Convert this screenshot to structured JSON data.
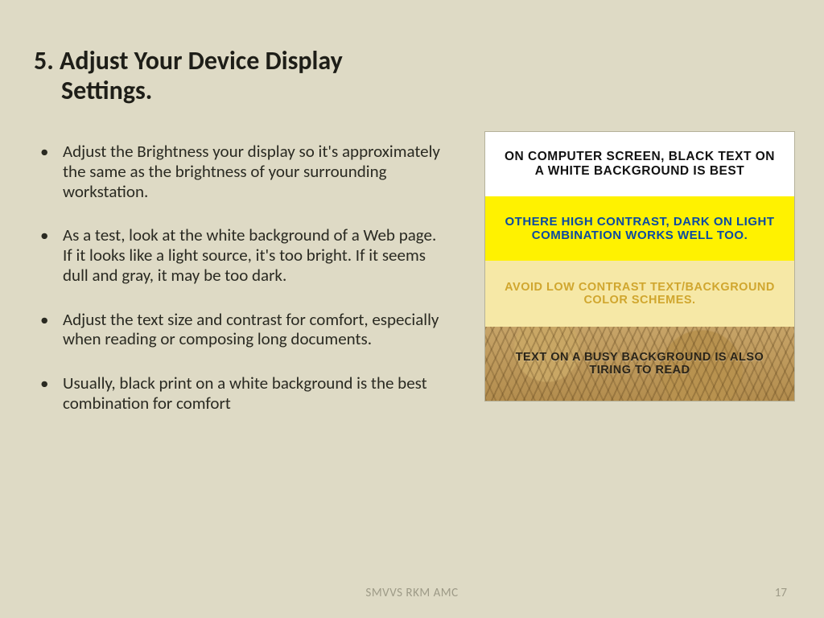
{
  "title": {
    "line1": "5. Adjust Your Device Display",
    "line2": "Settings."
  },
  "bullets": [
    "Adjust the Brightness your display so it's approximately the same as the brightness of your surrounding workstation.",
    "As a test, look at the white background of a Web page. If it looks like a light source, it's too bright. If it seems dull and gray, it may be too dark.",
    "Adjust the text size and contrast for comfort, especially when reading or composing long documents.",
    "Usually, black print on a white background is the best combination for comfort"
  ],
  "chart": {
    "panels": [
      "ON COMPUTER SCREEN, BLACK TEXT ON A WHITE BACKGROUND IS BEST",
      "OTHERE HIGH CONTRAST, DARK ON LIGHT COMBINATION WORKS WELL TOO.",
      "AVOID LOW CONTRAST TEXT/BACKGROUND COLOR SCHEMES.",
      "TEXT ON A BUSY BACKGROUND IS ALSO TIRING TO READ"
    ]
  },
  "footer": {
    "center": "SMVVS RKM AMC",
    "page": "17"
  }
}
